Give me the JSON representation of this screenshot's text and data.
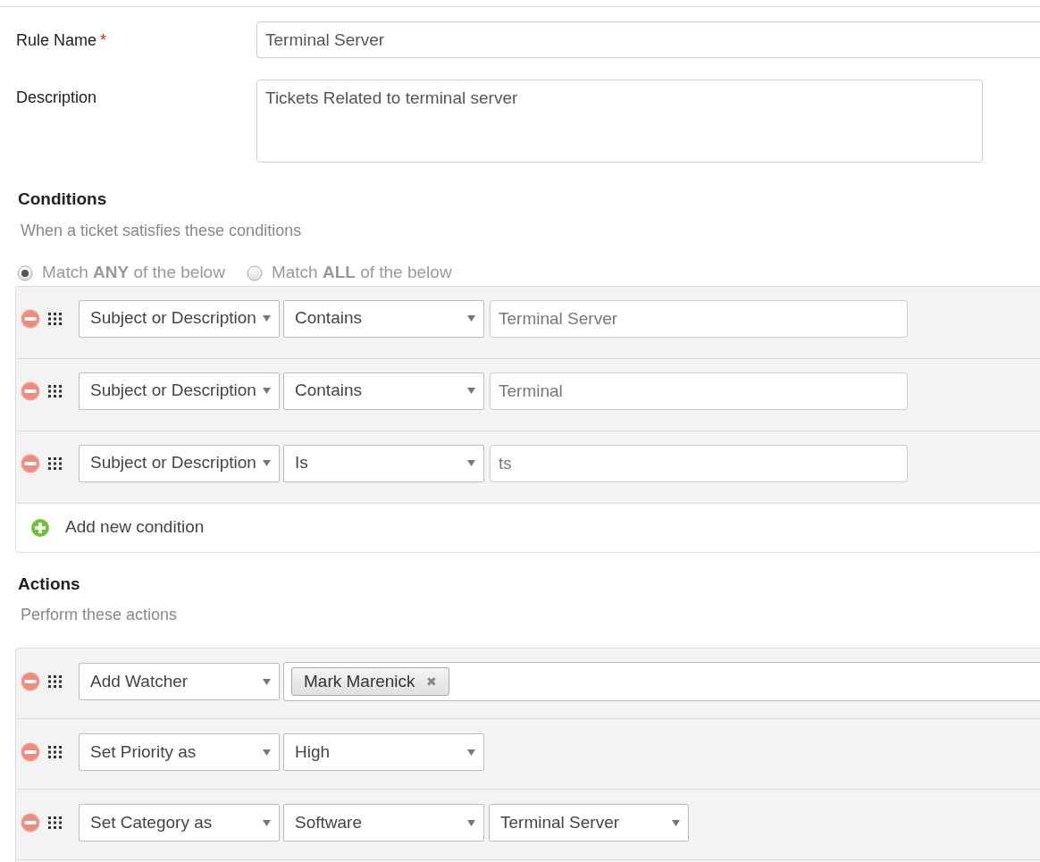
{
  "rule_name": {
    "label": "Rule Name",
    "required_mark": "*",
    "value": "Terminal Server"
  },
  "description": {
    "label": "Description",
    "value": "Tickets Related to terminal server"
  },
  "conditions": {
    "heading": "Conditions",
    "subtitle": "When a ticket satisfies these conditions",
    "match_options": [
      {
        "label": "Match **ANY** of the below",
        "selected": true
      },
      {
        "label": "Match **ALL** of the below",
        "selected": false
      }
    ],
    "rows": [
      {
        "field": "Subject or Description",
        "operator": "Contains",
        "value": "Terminal Server"
      },
      {
        "field": "Subject or Description",
        "operator": "Contains",
        "value": "Terminal"
      },
      {
        "field": "Subject or Description",
        "operator": "Is",
        "value": "ts"
      }
    ],
    "add_label": "Add new condition"
  },
  "actions": {
    "heading": "Actions",
    "subtitle": "Perform these actions",
    "rows": [
      {
        "kind": "tags",
        "action": "Add Watcher",
        "tags": [
          {
            "label": "Mark Marenick",
            "remove": "✖"
          }
        ]
      },
      {
        "kind": "selects",
        "action": "Set Priority as",
        "selects": [
          "High"
        ]
      },
      {
        "kind": "selects",
        "action": "Set Category as",
        "selects": [
          "Software",
          "Terminal Server"
        ]
      }
    ]
  }
}
